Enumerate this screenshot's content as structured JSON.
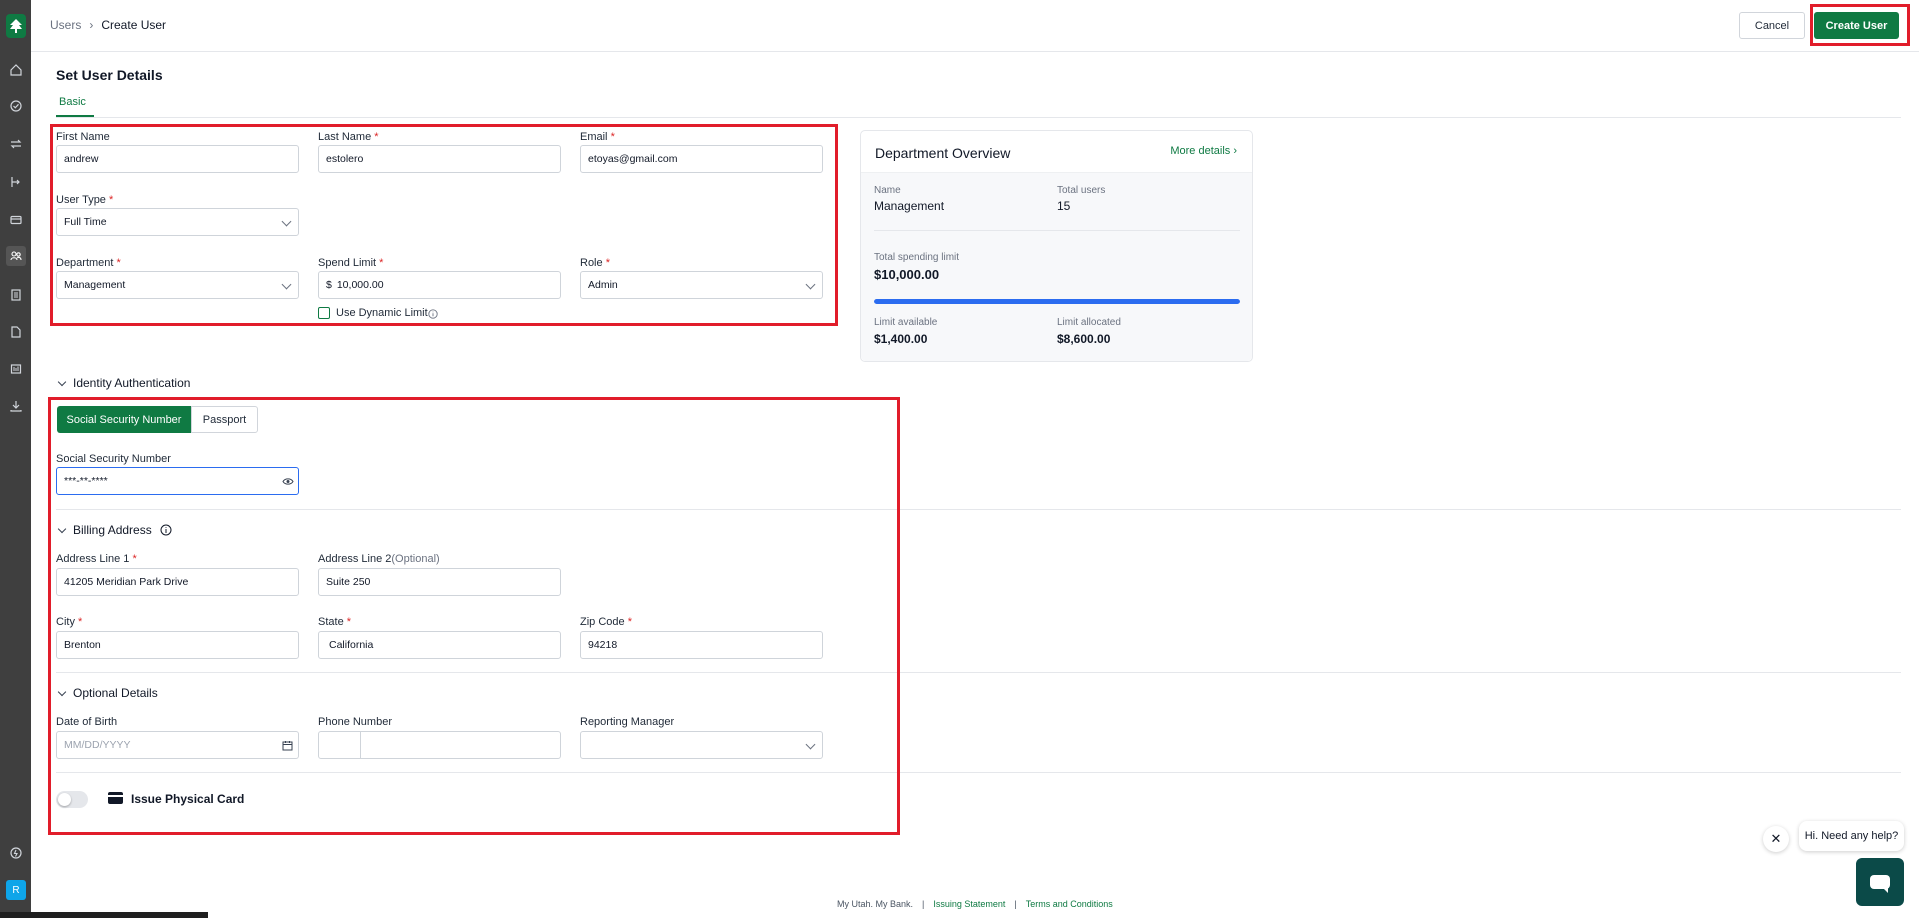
{
  "breadcrumb": {
    "parent": "Users",
    "separator": "›",
    "current": "Create User"
  },
  "header": {
    "cancel_label": "Cancel",
    "create_label": "Create User"
  },
  "page": {
    "title": "Set User Details",
    "tab_basic": "Basic"
  },
  "form": {
    "first_name": {
      "label": "First Name",
      "value": "andrew"
    },
    "last_name": {
      "label": "Last Name",
      "required": "*",
      "value": "estolero"
    },
    "email": {
      "label": "Email",
      "required": "*",
      "value": "etoyas@gmail.com"
    },
    "user_type": {
      "label": "User Type",
      "required": "*",
      "value": "Full Time"
    },
    "department": {
      "label": "Department",
      "required": "*",
      "value": "Management"
    },
    "spend_limit": {
      "label": "Spend Limit",
      "required": "*",
      "currency": "$",
      "value": "10,000.00"
    },
    "role": {
      "label": "Role",
      "required": "*",
      "value": "Admin"
    },
    "dynamic_limit": {
      "label": "Use Dynamic Limit",
      "checked": false
    }
  },
  "department_overview": {
    "title": "Department Overview",
    "more_label": "More details ›",
    "name_label": "Name",
    "name_value": "Management",
    "total_users_label": "Total users",
    "total_users_value": "15",
    "total_limit_label": "Total spending limit",
    "total_limit_value": "$10,000.00",
    "progress_fraction": 1.0,
    "available_label": "Limit available",
    "available_value": "$1,400.00",
    "allocated_label": "Limit allocated",
    "allocated_value": "$8,600.00"
  },
  "identity": {
    "section_title": "Identity Authentication",
    "seg_ssn": "Social Security Number",
    "seg_passport": "Passport",
    "ssn_label": "Social Security Number",
    "ssn_value": "***-**-****"
  },
  "billing": {
    "section_title": "Billing Address",
    "address1_label": "Address Line 1",
    "address1_value": "41205 Meridian Park Drive",
    "address2_label": "Address Line 2",
    "address2_optional": "(Optional)",
    "address2_value": "Suite 250",
    "city_label": "City",
    "city_value": "Brenton",
    "state_label": "State",
    "state_value": "California",
    "zip_label": "Zip Code",
    "zip_value": "94218"
  },
  "optional": {
    "section_title": "Optional Details",
    "dob_label": "Date of Birth",
    "dob_placeholder": "MM/DD/YYYY",
    "phone_label": "Phone Number",
    "manager_label": "Reporting Manager"
  },
  "card": {
    "label": "Issue Physical Card",
    "enabled": false
  },
  "footer": {
    "tagline": "My Utah. My Bank.",
    "sep": "|",
    "issuing": "Issuing Statement",
    "terms": "Terms and Conditions"
  },
  "help": {
    "bubble": "Hi. Need any help?",
    "close": "✕"
  },
  "sidebar": {
    "avatar": "R"
  },
  "colors": {
    "brand": "#0f7a43",
    "highlight": "#e11d2a",
    "progress": "#2b6cf0"
  }
}
